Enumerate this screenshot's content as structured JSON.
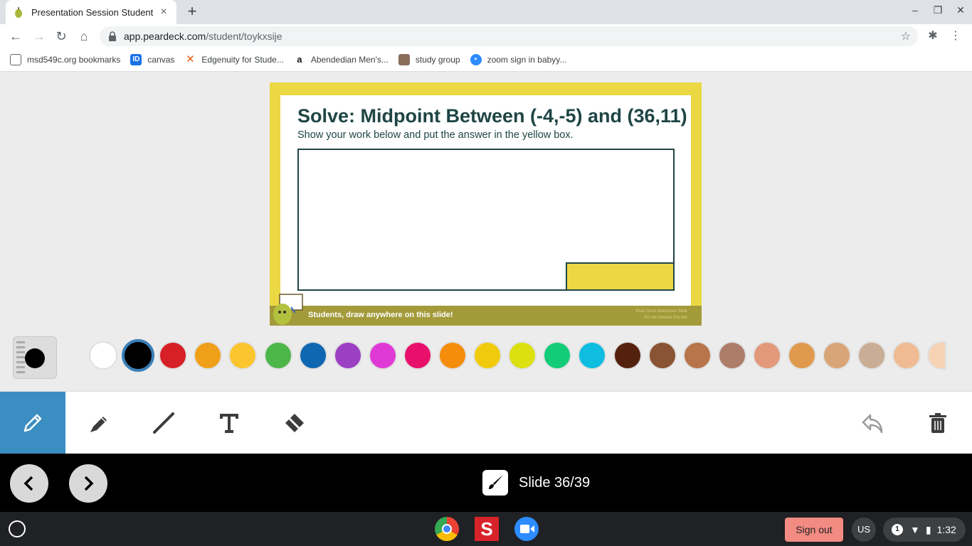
{
  "tab": {
    "title": "Presentation Session Student",
    "close": "×",
    "new_tab": "+"
  },
  "window": {
    "minimize": "–",
    "maximize": "❐",
    "close": "✕"
  },
  "address": {
    "domain": "app.peardeck.com",
    "path": "/student/toykxsije"
  },
  "bookmarks": [
    {
      "label": "msd549c.org bookmarks",
      "icon": "folder-icon"
    },
    {
      "label": "canvas",
      "icon": "canvas-icon"
    },
    {
      "label": "Edgenuity for Stude...",
      "icon": "edgenuity-icon"
    },
    {
      "label": "Abendedian Men's...",
      "icon": "amazon-icon"
    },
    {
      "label": "study group",
      "icon": "photo-icon"
    },
    {
      "label": "zoom sign in babyy...",
      "icon": "zoom-icon"
    }
  ],
  "slide": {
    "title": "Solve: Midpoint Between (-4,-5) and (36,11)",
    "subtitle": "Show your work below and put the answer in the yellow box.",
    "footer": "Students, draw anywhere on this slide!",
    "footer_right_1": "Pear Deck Interactive Slide",
    "footer_right_2": "Do not remove this bar"
  },
  "palette": {
    "selected": "#000000",
    "colors": [
      "#ffffff",
      "#000000",
      "#d61f26",
      "#f0a018",
      "#fbc52d",
      "#4cb648",
      "#0f67b1",
      "#9b3fc4",
      "#e03ad6",
      "#e8106b",
      "#f58c0a",
      "#f0cb0d",
      "#dbe00e",
      "#12cc78",
      "#0fbde0",
      "#54210f",
      "#8a5334",
      "#b8754a",
      "#ad7d6a",
      "#e2997b",
      "#e09a4e",
      "#d8a578",
      "#c9ad95",
      "#f0bb93",
      "#f7d3b5"
    ]
  },
  "tools": [
    "pencil-icon",
    "marker-icon",
    "line-icon",
    "text-icon",
    "eraser-icon"
  ],
  "nav": {
    "slide_count": "Slide 36/39"
  },
  "shelf": {
    "signout": "Sign out",
    "ime": "US",
    "notifications": "1",
    "time": "1:32"
  }
}
